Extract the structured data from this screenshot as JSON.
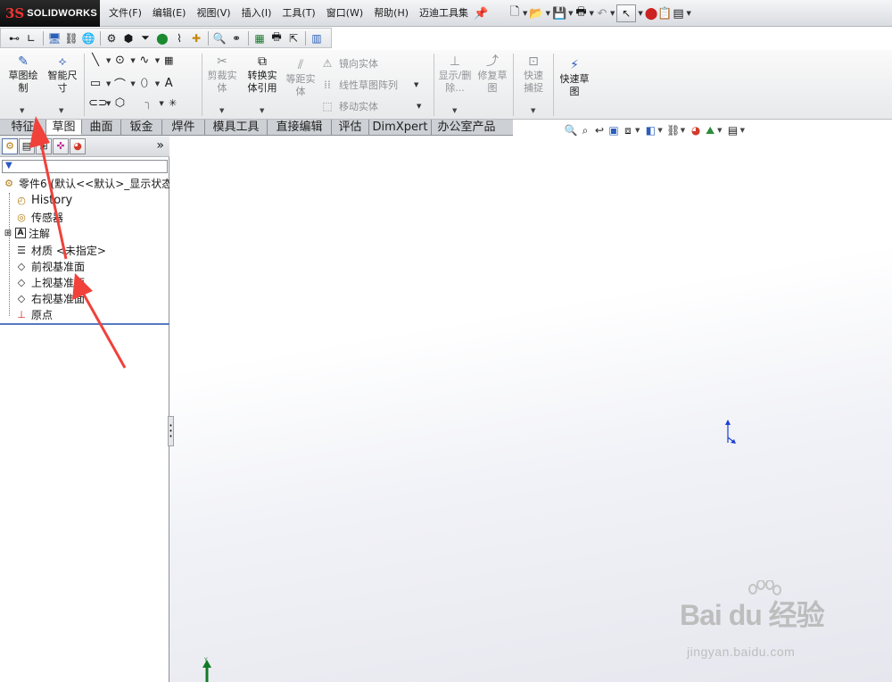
{
  "app": {
    "logo_mark": "3S",
    "logo_text": "SOLIDWORKS"
  },
  "menu": [
    "文件(F)",
    "编辑(E)",
    "视图(V)",
    "插入(I)",
    "工具(T)",
    "窗口(W)",
    "帮助(H)",
    "迈迪工具集"
  ],
  "command_manager": {
    "sketch": "草图绘制",
    "smart_dimension": "智能尺寸",
    "trim": "剪裁实体",
    "convert": "转换实体引用",
    "offset": "等距实体",
    "mirror": "镜向实体",
    "linear_pattern": "线性草图阵列",
    "move": "移动实体",
    "show_delete": "显示/删除...",
    "repair": "修复草图",
    "quick_snap": "快速捕捉",
    "quick_sketch": "快速草图"
  },
  "tabs": [
    "特征",
    "草图",
    "曲面",
    "钣金",
    "焊件",
    "模具工具",
    "直接编辑",
    "评估",
    "DimXpert",
    "办公室产品"
  ],
  "active_tab": "草图",
  "feature_tree": {
    "root": "零件6 (默认<<默认>_显示状态",
    "items": [
      "History",
      "传感器",
      "注解",
      "材质 <未指定>",
      "前视基准面",
      "上视基准面",
      "右视基准面",
      "原点"
    ]
  },
  "watermark": {
    "main": "Bai du 经验",
    "sub": "jingyan.baidu.com"
  },
  "colors": {
    "accent_red": "#f0413a",
    "tree_selection_blue": "#5579c0",
    "origin_blue": "#1a3fd1"
  }
}
